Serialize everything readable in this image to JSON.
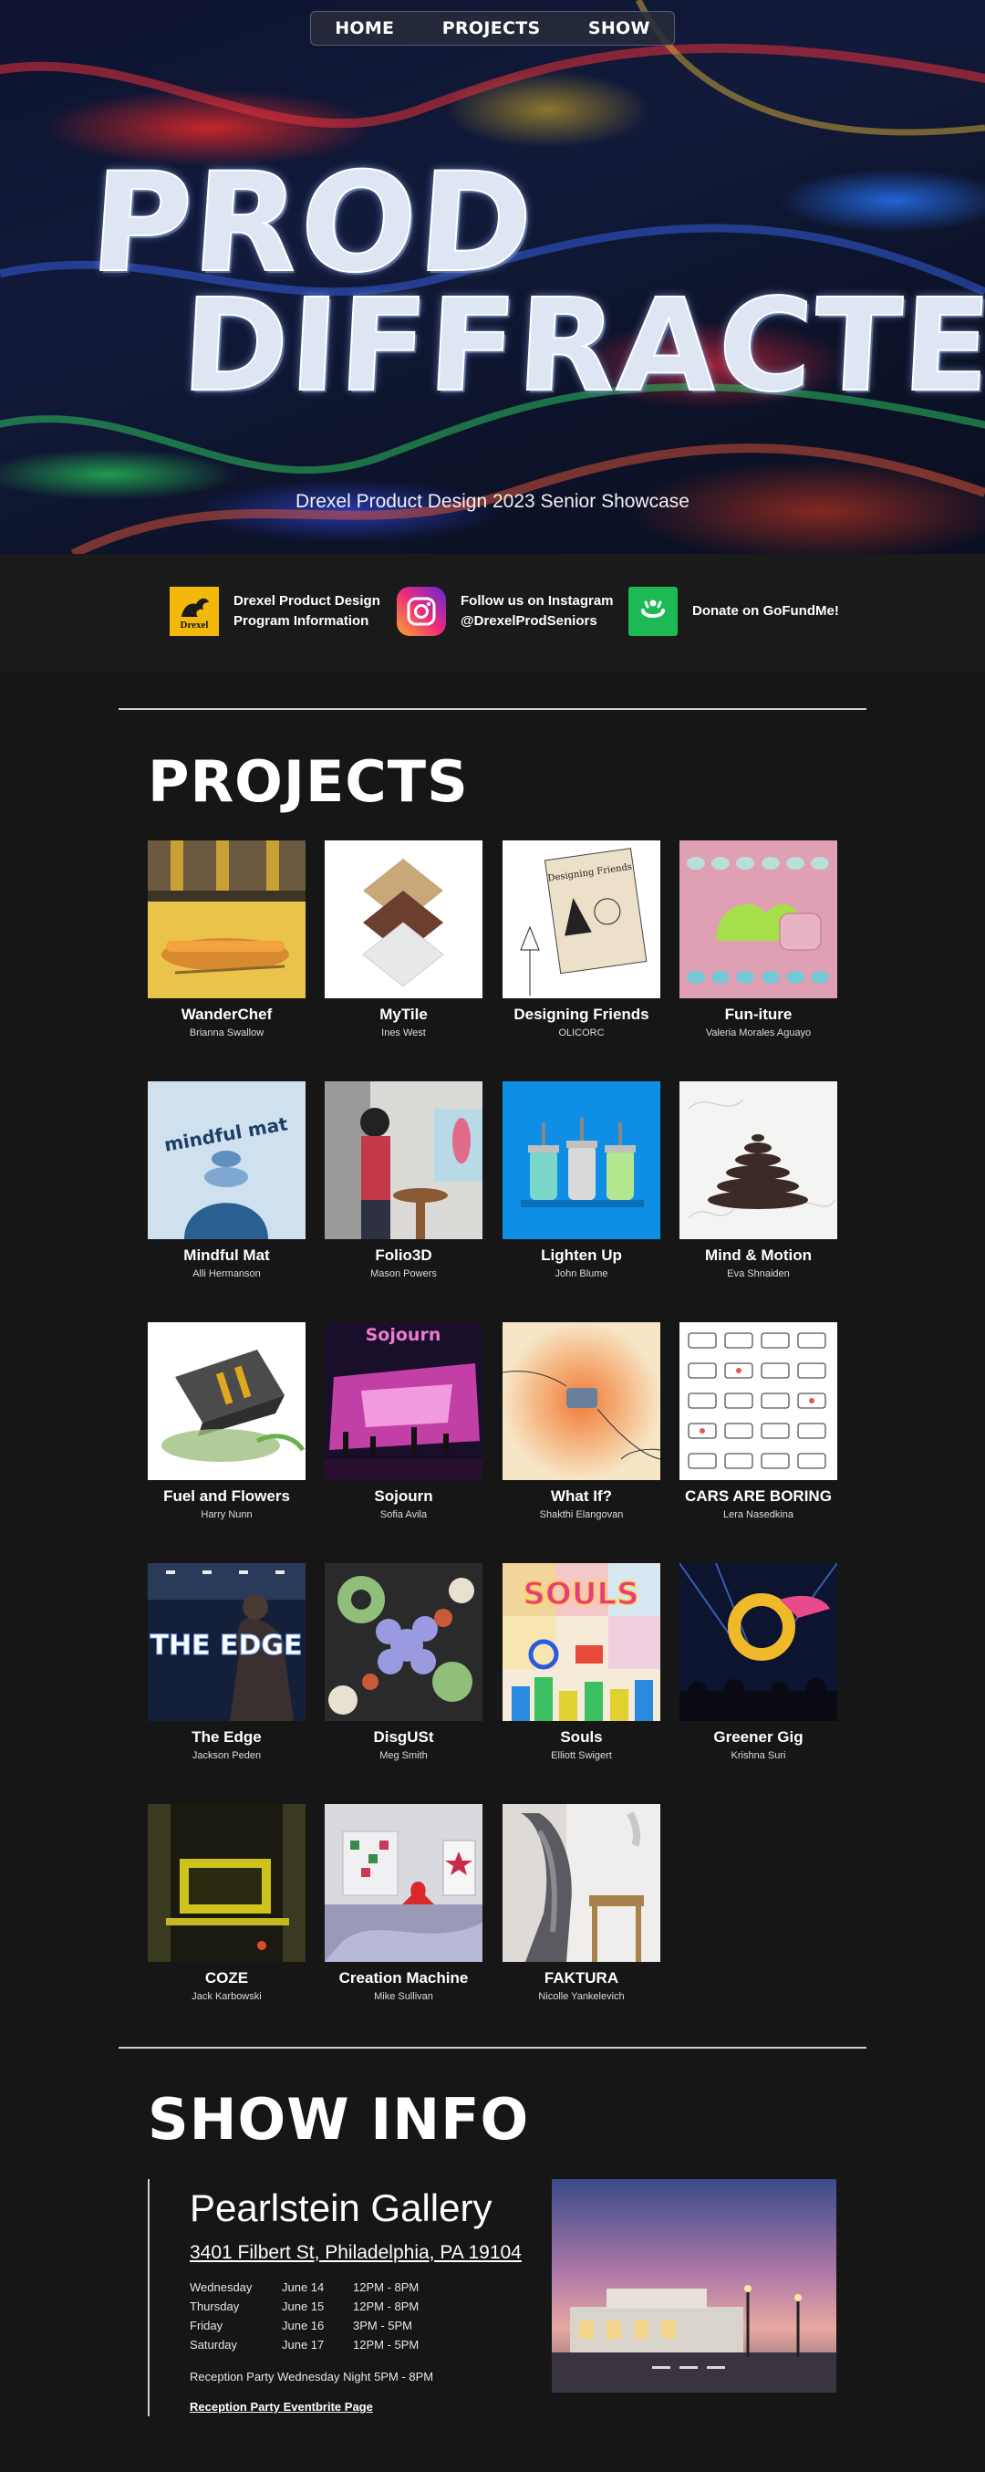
{
  "nav": {
    "home": "HOME",
    "projects": "PROJECTS",
    "show": "SHOW"
  },
  "hero": {
    "title_line1": "PROD",
    "title_line2": "DIFFRACTED",
    "subtitle": "Drexel Product Design 2023 Senior Showcase"
  },
  "links": {
    "program": {
      "icon": "drexel-dragon-icon",
      "line1": "Drexel Product Design",
      "line2": "Program Information",
      "logo_text": "Drexel"
    },
    "instagram": {
      "icon": "instagram-icon",
      "line1": "Follow us on Instagram",
      "line2": "@DrexelProdSeniors"
    },
    "gofundme": {
      "icon": "gofundme-icon",
      "line1": "Donate on GoFundMe!"
    }
  },
  "projects_section": {
    "title": "PROJECTS"
  },
  "projects": [
    {
      "title": "WanderChef",
      "author": "Brianna Swallow"
    },
    {
      "title": "MyTile",
      "author": "Ines West"
    },
    {
      "title": "Designing Friends",
      "author": "OLICORC",
      "thumb_text": "Designing Friends"
    },
    {
      "title": "Fun-iture",
      "author": "Valeria Morales Aguayo"
    },
    {
      "title": "Mindful Mat",
      "author": "Alli Hermanson",
      "thumb_text": "mindful mat"
    },
    {
      "title": "Folio3D",
      "author": "Mason Powers"
    },
    {
      "title": "Lighten Up",
      "author": "John Blume"
    },
    {
      "title": "Mind & Motion",
      "author": "Eva Shnaiden"
    },
    {
      "title": "Fuel and Flowers",
      "author": "Harry Nunn"
    },
    {
      "title": "Sojourn",
      "author": "Sofia Avila",
      "thumb_text": "Sojourn"
    },
    {
      "title": "What If?",
      "author": "Shakthi Elangovan"
    },
    {
      "title": "CARS ARE BORING",
      "author": "Lera Nasedkina"
    },
    {
      "title": "The Edge",
      "author": "Jackson Peden",
      "thumb_text": "THE EDGE"
    },
    {
      "title": "DisgUSt",
      "author": "Meg Smith"
    },
    {
      "title": "Souls",
      "author": "Elliott Swigert",
      "thumb_text": "SOULS"
    },
    {
      "title": "Greener Gig",
      "author": "Krishna Suri"
    },
    {
      "title": "COZE",
      "author": "Jack Karbowski"
    },
    {
      "title": "Creation Machine",
      "author": "Mike Sullivan"
    },
    {
      "title": "FAKTURA",
      "author": "Nicolle Yankelevich"
    }
  ],
  "show_section": {
    "title": "SHOW INFO",
    "venue": "Pearlstein Gallery",
    "address": "3401 Filbert St, Philadelphia, PA 19104",
    "hours": [
      {
        "day": "Wednesday",
        "date": "June 14",
        "time": "12PM - 8PM"
      },
      {
        "day": "Thursday",
        "date": "June 15",
        "time": "12PM - 8PM"
      },
      {
        "day": "Friday",
        "date": "June 16",
        "time": "3PM - 5PM"
      },
      {
        "day": "Saturday",
        "date": "June 17",
        "time": "12PM - 5PM"
      }
    ],
    "reception": "Reception Party Wednesday Night 5PM - 8PM",
    "eventbrite_link": "Reception Party Eventbrite Page"
  }
}
